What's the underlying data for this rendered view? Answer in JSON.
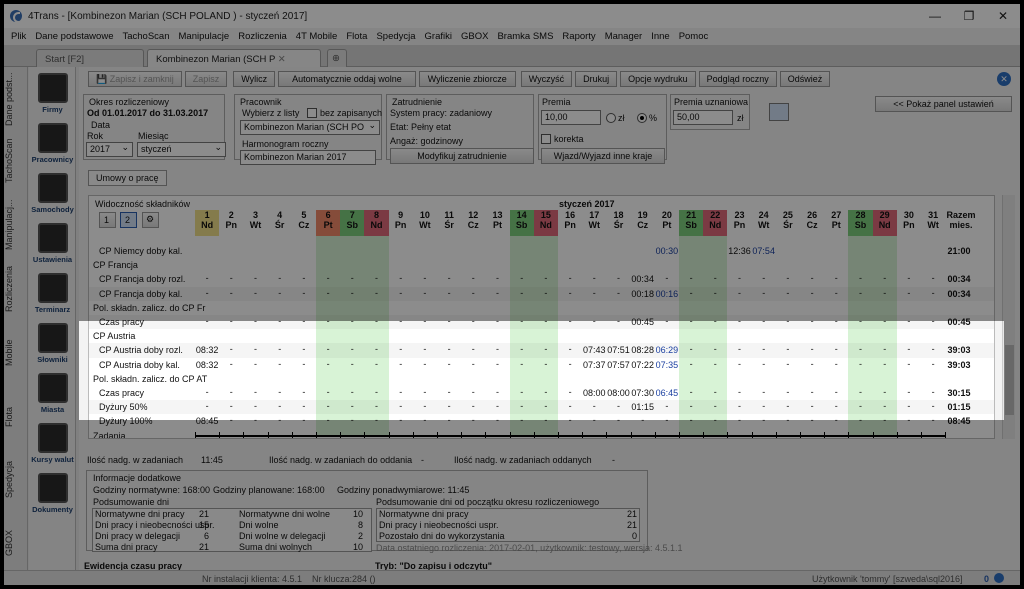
{
  "window": {
    "title": "4Trans - [Kombinezon Marian (SCH POLAND ) - styczeń 2017]"
  },
  "menu": [
    "Plik",
    "Dane podstawowe",
    "TachoScan",
    "Manipulacje",
    "Rozliczenia",
    "4T Mobile",
    "Flota",
    "Spedycja",
    "Grafiki",
    "GBOX",
    "Bramka SMS",
    "Raporty",
    "Manager",
    "Inne",
    "Pomoc"
  ],
  "tabs": {
    "start": "Start [F2]",
    "active": "Kombinezon Marian (SCH P"
  },
  "vertical_tabs": [
    "Dane podst...",
    "TachoScan",
    "Manipulacj...",
    "Rozliczenia",
    "Mobile",
    "Flota",
    "Spedycja",
    "GBOX"
  ],
  "modules": [
    "Firmy",
    "Pracownicy",
    "Samochody",
    "Ustawienia",
    "Terminarz",
    "Słowniki",
    "Miasta",
    "Kursy walut",
    "Dokumenty"
  ],
  "toolbar": {
    "save_close": "Zapisz i zamknij",
    "save": "Zapisz",
    "calc": "Wylicz",
    "auto": "Automatycznie oddaj wolne",
    "summary": "Wyliczenie zbiorcze",
    "clear": "Wyczyść",
    "print": "Drukuj",
    "print_opts": "Opcje wydruku",
    "annual": "Podgląd roczny",
    "refresh": "Odśwież",
    "settings_panel": "<< Pokaż panel ustawień"
  },
  "period": {
    "legend": "Okres rozliczeniowy",
    "range": "Od 01.01.2017 do 31.03.2017",
    "date_legend": "Data",
    "year_label": "Rok",
    "year": "2017",
    "month_label": "Miesiąc",
    "month": "styczeń"
  },
  "employee": {
    "legend": "Pracownik",
    "choose": "Wybierz z listy",
    "no_saved": "bez zapisanych",
    "name": "Kombinezon Marian (SCH PO",
    "schedule_label": "Harmonogram roczny",
    "schedule": "Kombinezon Marian 2017"
  },
  "employment": {
    "legend": "Zatrudnienie",
    "system": "System pracy: zadaniowy",
    "etat": "Etat: Pełny etat",
    "angaz": "Angaż: godzinowy",
    "modify": "Modyfikuj zatrudnienie",
    "correction": "korekta",
    "trips": "Wjazd/Wyjazd inne kraje"
  },
  "bonus": {
    "legend": "Premia",
    "value": "10,00",
    "zl": "zł",
    "pct": "%",
    "disc_legend": "Premia uznaniowa",
    "disc_value": "50,00",
    "disc_zl": "zł"
  },
  "contract_tab": "Umowy o pracę",
  "grid": {
    "visibility": "Widoczność składników",
    "month_title": "styczeń 2017",
    "total_header": "Razem",
    "total_sub": "mies.",
    "btn1": "1",
    "btn2": "2",
    "days": [
      [
        "1",
        "Nd"
      ],
      [
        "2",
        "Pn"
      ],
      [
        "3",
        "Wt"
      ],
      [
        "4",
        "Śr"
      ],
      [
        "5",
        "Cz"
      ],
      [
        "6",
        "Pt"
      ],
      [
        "7",
        "Sb"
      ],
      [
        "8",
        "Nd"
      ],
      [
        "9",
        "Pn"
      ],
      [
        "10",
        "Wt"
      ],
      [
        "11",
        "Śr"
      ],
      [
        "12",
        "Cz"
      ],
      [
        "13",
        "Pt"
      ],
      [
        "14",
        "Sb"
      ],
      [
        "15",
        "Nd"
      ],
      [
        "16",
        "Pn"
      ],
      [
        "17",
        "Wt"
      ],
      [
        "18",
        "Śr"
      ],
      [
        "19",
        "Cz"
      ],
      [
        "20",
        "Pt"
      ],
      [
        "21",
        "Sb"
      ],
      [
        "22",
        "Nd"
      ],
      [
        "23",
        "Pn"
      ],
      [
        "24",
        "Wt"
      ],
      [
        "25",
        "Śr"
      ],
      [
        "26",
        "Cz"
      ],
      [
        "27",
        "Pt"
      ],
      [
        "28",
        "Sb"
      ],
      [
        "29",
        "Nd"
      ],
      [
        "30",
        "Pn"
      ],
      [
        "31",
        "Wt"
      ]
    ],
    "rows": [
      {
        "label": "CP Niemcy doby kal.",
        "indent": 1,
        "cells": {
          "20": "00:30",
          "23": "12:36",
          "24": "07:54"
        },
        "total": "21:00",
        "dash": false
      },
      {
        "label": "CP Francja",
        "indent": 0,
        "cells": {},
        "total": "",
        "dash": false,
        "section": true
      },
      {
        "label": "CP Francja doby rozl.",
        "indent": 1,
        "cells": {
          "19": "00:34"
        },
        "total": "00:34",
        "dash": true
      },
      {
        "label": "CP Francja doby kal.",
        "indent": 1,
        "cells": {
          "19": "00:18",
          "20": "00:16"
        },
        "total": "00:34",
        "dash": true
      },
      {
        "label": "Pol. składn. zalicz. do CP Fr",
        "indent": 0,
        "cells": {},
        "total": "",
        "dash": false,
        "section": true
      },
      {
        "label": "Czas pracy",
        "indent": 1,
        "cells": {
          "19": "00:45"
        },
        "total": "00:45",
        "dash": true
      },
      {
        "label": "CP Austria",
        "indent": 0,
        "cells": {},
        "total": "",
        "dash": false,
        "section": true
      },
      {
        "label": "CP Austria doby rozl.",
        "indent": 1,
        "cells": {
          "1": "08:32",
          "17": "07:43",
          "18": "07:51",
          "19": "08:28",
          "20": "06:29"
        },
        "total": "39:03",
        "dash": true
      },
      {
        "label": "CP Austria doby kal.",
        "indent": 1,
        "cells": {
          "1": "08:32",
          "17": "07:37",
          "18": "07:57",
          "19": "07:22",
          "20": "07:35"
        },
        "total": "39:03",
        "dash": true
      },
      {
        "label": "Pol. składn. zalicz. do CP AT",
        "indent": 0,
        "cells": {},
        "total": "",
        "dash": false,
        "section": true
      },
      {
        "label": "Czas pracy",
        "indent": 1,
        "cells": {
          "17": "08:00",
          "18": "08:00",
          "19": "07:30",
          "20": "06:45"
        },
        "total": "30:15",
        "dash": true
      },
      {
        "label": "Dyżury 50%",
        "indent": 1,
        "cells": {
          "19": "01:15"
        },
        "total": "01:15",
        "dash": true
      },
      {
        "label": "Dyżury 100%",
        "indent": 1,
        "cells": {
          "1": "08:45"
        },
        "total": "08:45",
        "dash": true
      },
      {
        "label": "Zadania",
        "indent": 0,
        "cells": {},
        "total": "",
        "dash": false,
        "tasks": true
      }
    ]
  },
  "overtime": {
    "tasks": "Ilość nadg. w zadaniach",
    "tasks_val": "11:45",
    "to_give": "Ilość nadg. w zadaniach do oddania",
    "to_give_val": "-",
    "given": "Ilość nadg. w zadaniach oddanych",
    "given_val": "-"
  },
  "info": {
    "legend": "Informacje dodatkowe",
    "normative": "Godziny normatywne: 168:00",
    "planned": "Godziny planowane: 168:00",
    "overtime": "Godziny ponadwymiarowe: 11:45",
    "days_summary": "Podsumowanie dni",
    "period_summary": "Podsumowanie dni od początku okresu rozliczeniowego",
    "left_table": [
      [
        "Normatywne dni pracy",
        "21",
        "Normatywne dni wolne",
        "10"
      ],
      [
        "Dni pracy i nieobecności uspr.",
        "15",
        "Dni wolne",
        "8"
      ],
      [
        "Dni pracy w delegacji",
        "6",
        "Dni wolne w delegacji",
        "2"
      ],
      [
        "Suma dni pracy",
        "21",
        "Suma dni wolnych",
        "10"
      ]
    ],
    "right_table": [
      [
        "Normatywne dni pracy",
        "21"
      ],
      [
        "Dni pracy i nieobecności uspr.",
        "21"
      ],
      [
        "Pozostało dni do wykorzystania",
        "0"
      ]
    ],
    "last_calc": "Data ostatniego rozliczenia: 2017-02-01, użytkownik: testowy, wersja: 4.5.1.1"
  },
  "footer": {
    "left": "Ewidencja czasu pracy",
    "mode": "Tryb: \"Do zapisu i odczytu\""
  },
  "status": {
    "install": "Nr instalacji klienta: 4.5.1",
    "key": "Nr klucza:284 ()",
    "user": "Użytkownik 'tommy'  [szweda\\sql2016]",
    "count": "0"
  }
}
